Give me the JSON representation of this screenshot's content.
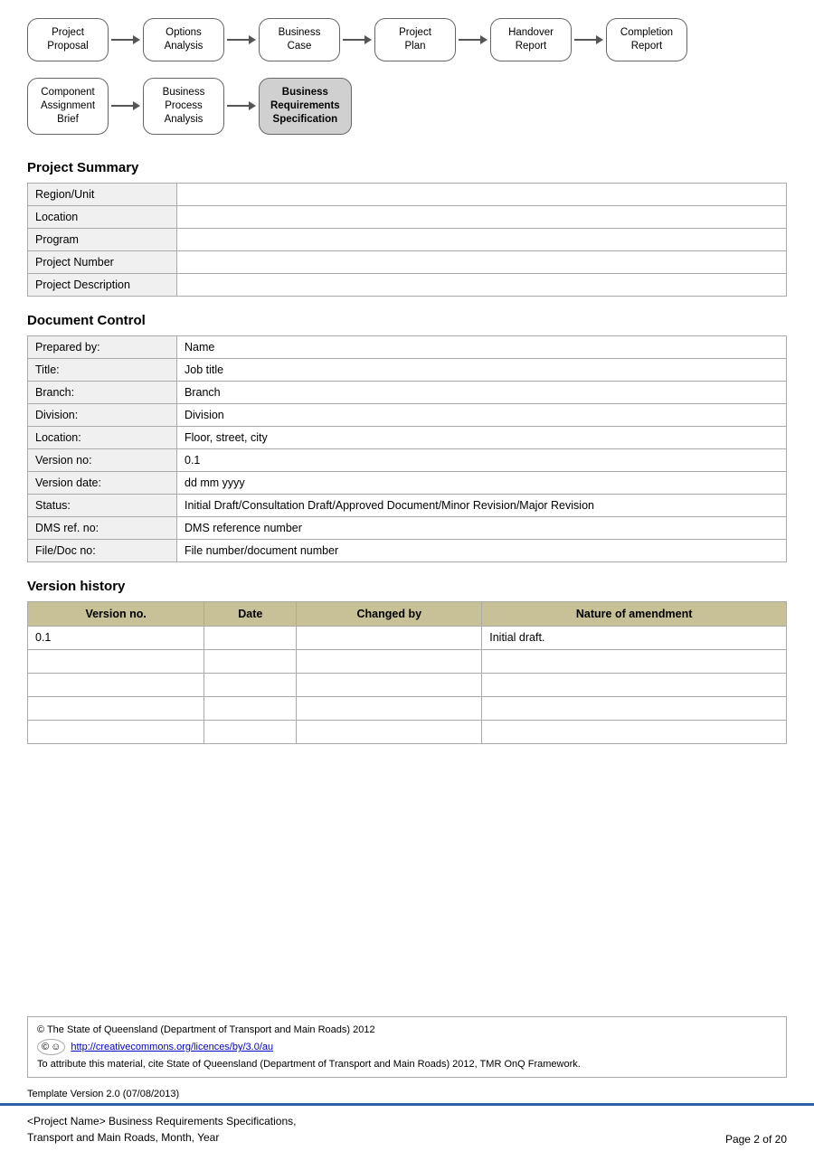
{
  "flow1": {
    "nodes": [
      {
        "id": "project-proposal",
        "label": "Project\nProposal",
        "highlighted": false
      },
      {
        "id": "options-analysis",
        "label": "Options\nAnalysis",
        "highlighted": false
      },
      {
        "id": "business-case",
        "label": "Business\nCase",
        "highlighted": false
      },
      {
        "id": "project-plan",
        "label": "Project\nPlan",
        "highlighted": false
      },
      {
        "id": "handover-report",
        "label": "Handover\nReport",
        "highlighted": false
      },
      {
        "id": "completion-report",
        "label": "Completion\nReport",
        "highlighted": false
      }
    ]
  },
  "flow2": {
    "nodes": [
      {
        "id": "component-assignment-brief",
        "label": "Component\nAssignment\nBrief",
        "highlighted": false
      },
      {
        "id": "business-process-analysis",
        "label": "Business\nProcess\nAnalysis",
        "highlighted": false
      },
      {
        "id": "business-requirements-spec",
        "label": "Business\nRequirements\nSpecification",
        "highlighted": true
      }
    ]
  },
  "project_summary": {
    "title": "Project Summary",
    "rows": [
      {
        "label": "Region/Unit",
        "value": ""
      },
      {
        "label": "Location",
        "value": ""
      },
      {
        "label": "Program",
        "value": ""
      },
      {
        "label": "Project Number",
        "value": ""
      },
      {
        "label": "Project Description",
        "value": ""
      }
    ]
  },
  "document_control": {
    "title": "Document Control",
    "rows": [
      {
        "label": "Prepared by:",
        "value": "Name"
      },
      {
        "label": "Title:",
        "value": "Job title"
      },
      {
        "label": "Branch:",
        "value": "Branch"
      },
      {
        "label": "Division:",
        "value": "Division"
      },
      {
        "label": "Location:",
        "value": "Floor, street, city"
      },
      {
        "label": "Version no:",
        "value": "0.1"
      },
      {
        "label": "Version date:",
        "value": "dd mm yyyy"
      },
      {
        "label": "Status:",
        "value": "Initial Draft/Consultation Draft/Approved Document/Minor Revision/Major Revision"
      },
      {
        "label": "DMS ref. no:",
        "value": "DMS reference number"
      },
      {
        "label": "File/Doc no:",
        "value": "File number/document number"
      }
    ]
  },
  "version_history": {
    "title": "Version history",
    "headers": [
      "Version no.",
      "Date",
      "Changed by",
      "Nature of amendment"
    ],
    "rows": [
      {
        "version": "0.1",
        "date": "",
        "changed_by": "",
        "nature": "Initial draft."
      },
      {
        "version": "",
        "date": "",
        "changed_by": "",
        "nature": ""
      },
      {
        "version": "",
        "date": "",
        "changed_by": "",
        "nature": ""
      },
      {
        "version": "",
        "date": "",
        "changed_by": "",
        "nature": ""
      },
      {
        "version": "",
        "date": "",
        "changed_by": "",
        "nature": ""
      }
    ]
  },
  "footer": {
    "copyright": "© The State of Queensland (Department of Transport and Main Roads) 2012",
    "cc_link": "http://creativecommons.org/licences/by/3.0/au",
    "attribution": "To attribute this material, cite State of Queensland (Department of Transport and Main Roads) 2012, TMR OnQ Framework.",
    "template_version": "Template Version 2.0 (07/08/2013)"
  },
  "page_footer": {
    "left_line1": "<Project Name> Business Requirements Specifications,",
    "left_line2": "Transport and Main Roads, Month, Year",
    "right": "Page 2 of 20"
  }
}
